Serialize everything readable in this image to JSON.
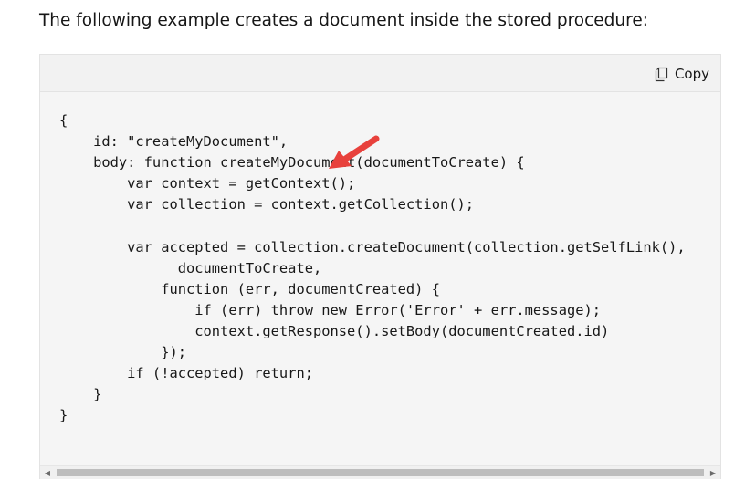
{
  "intro_text": "The following example creates a document inside the stored procedure:",
  "copy_button": {
    "label": "Copy",
    "icon": "copy-icon"
  },
  "code_lines": [
    "{",
    "    id: \"createMyDocument\",",
    "    body: function createMyDocument(documentToCreate) {",
    "        var context = getContext();",
    "        var collection = context.getCollection();",
    "",
    "        var accepted = collection.createDocument(collection.getSelfLink(),",
    "              documentToCreate,",
    "            function (err, documentCreated) {",
    "                if (err) throw new Error('Error' + err.message);",
    "                context.getResponse().setBody(documentCreated.id)",
    "            });",
    "        if (!accepted) return;",
    "    }",
    "}"
  ],
  "annotation": {
    "icon": "red-arrow-icon",
    "color": "#e8413c"
  },
  "scrollbar": {
    "left_icon": "scroll-left-arrow-icon",
    "right_icon": "scroll-right-arrow-icon"
  }
}
